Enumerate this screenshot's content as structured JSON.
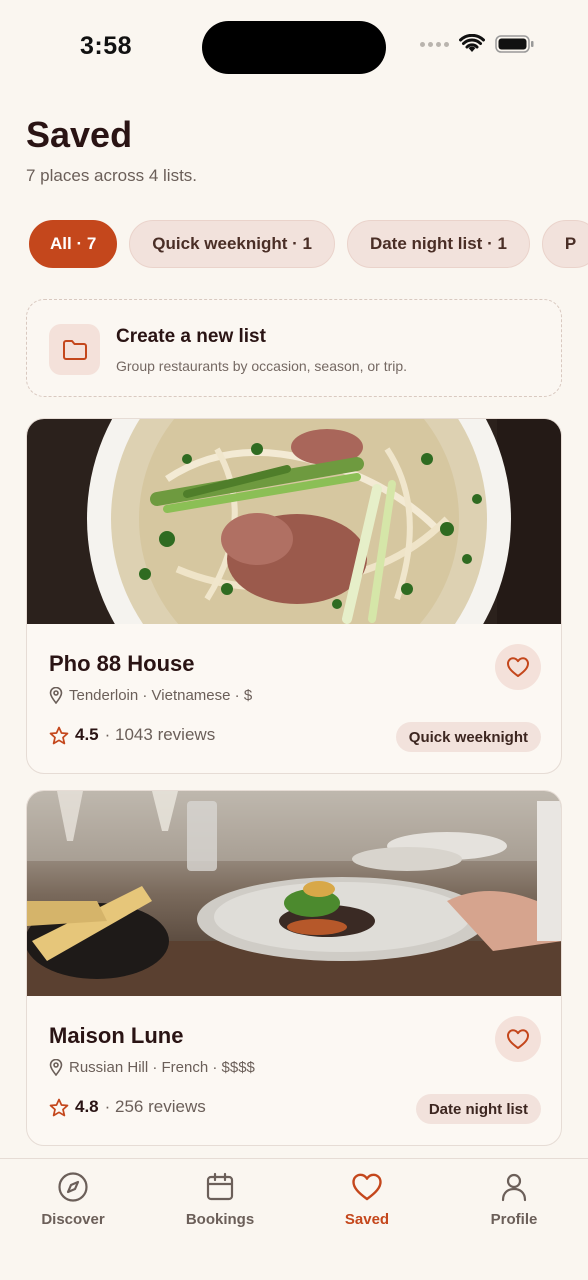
{
  "status_bar": {
    "time": "3:58"
  },
  "header": {
    "title": "Saved",
    "subtitle": "7 places across 4 lists."
  },
  "chips": [
    {
      "label": "All · 7",
      "active": true
    },
    {
      "label": "Quick weeknight · 1",
      "active": false
    },
    {
      "label": "Date night list · 1",
      "active": false
    },
    {
      "label": "P",
      "active": false
    }
  ],
  "create_list": {
    "title": "Create a new list",
    "subtitle": "Group restaurants by occasion, season, or trip.",
    "icon": "folder-icon"
  },
  "restaurants": [
    {
      "name": "Pho 88 House",
      "meta": "Tenderloin · Vietnamese · $",
      "rating": "4.5",
      "reviews": "· 1043 reviews",
      "tag": "Quick weeknight"
    },
    {
      "name": "Maison Lune",
      "meta": "Russian Hill · French · $$$$",
      "rating": "4.8",
      "reviews": "· 256 reviews",
      "tag": "Date night list"
    }
  ],
  "tabs": [
    {
      "label": "Discover",
      "icon": "compass-icon"
    },
    {
      "label": "Bookings",
      "icon": "calendar-icon"
    },
    {
      "label": "Saved",
      "icon": "heart-icon",
      "active": true
    },
    {
      "label": "Profile",
      "icon": "person-icon"
    }
  ],
  "colors": {
    "accent": "#c4471c",
    "background": "#faf6f0",
    "chip": "#f2e2dc"
  }
}
